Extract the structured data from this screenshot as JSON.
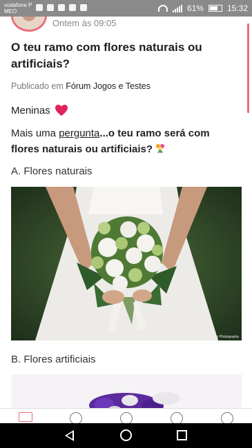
{
  "status_bar": {
    "carrier": "vodafone P",
    "carrier_sub": "MEO",
    "battery_percent": "61%",
    "time": "15:32",
    "background": "#8a8a8a"
  },
  "post": {
    "timestamp": "Ontem às 09:05",
    "title": "O teu ramo com flores naturais ou artificiais?",
    "published_prefix": "Publicado em",
    "forum_name": "Fórum Jogos e Testes",
    "greeting": "Meninas",
    "question_prefix": "Mais uma ",
    "question_link": "pergunta",
    "question_suffix": "...o teu ramo será com flores naturais ou artificiais?",
    "option_a": "A. Flores naturais",
    "option_b": "B. Flores artificiais",
    "photo_credit": "casamentos.pt · Helena Tomás Photography"
  },
  "icons": {
    "heart": "heart-icon",
    "flower": "flower-bouquet-icon"
  },
  "colors": {
    "accent": "#e96a74",
    "heart": "#e0245e",
    "text": "#222222",
    "muted": "#777777"
  }
}
